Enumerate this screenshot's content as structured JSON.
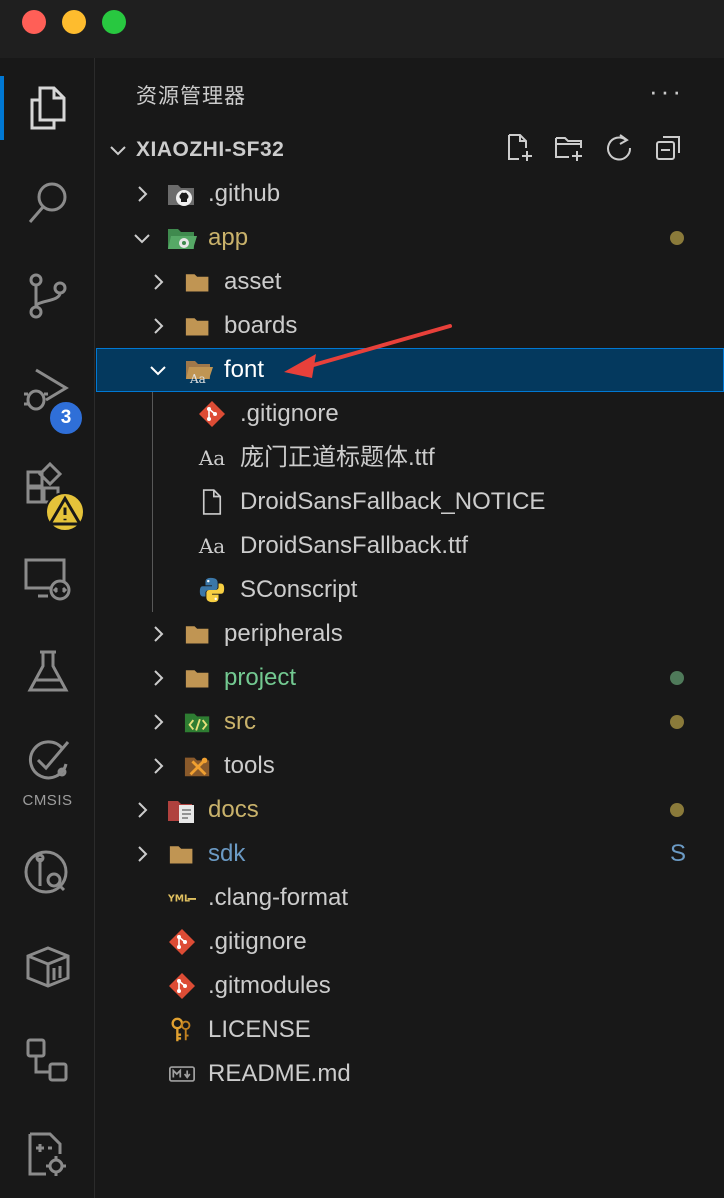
{
  "sidebar": {
    "title": "资源管理器",
    "more_label": "···",
    "root": {
      "label": "XIAOZHI-SF32"
    }
  },
  "activity": {
    "run_badge": "3",
    "cmsis_label": "CMSIS"
  },
  "tree": [
    {
      "label": ".github",
      "color": "#cccccc",
      "deco": ""
    },
    {
      "label": "app",
      "color": "#c9b26b",
      "deco": "#8a7a3a"
    },
    {
      "label": "asset",
      "color": "#cccccc",
      "deco": ""
    },
    {
      "label": "boards",
      "color": "#cccccc",
      "deco": ""
    },
    {
      "label": "font",
      "color": "#ffffff",
      "deco": ""
    },
    {
      "label": ".gitignore",
      "color": "#cccccc",
      "deco": ""
    },
    {
      "label": "庞门正道标题体.ttf",
      "color": "#cccccc",
      "deco": ""
    },
    {
      "label": "DroidSansFallback_NOTICE",
      "color": "#cccccc",
      "deco": ""
    },
    {
      "label": "DroidSansFallback.ttf",
      "color": "#cccccc",
      "deco": ""
    },
    {
      "label": "SConscript",
      "color": "#cccccc",
      "deco": ""
    },
    {
      "label": "peripherals",
      "color": "#cccccc",
      "deco": ""
    },
    {
      "label": "project",
      "color": "#73c991",
      "deco": "#4f7a5a"
    },
    {
      "label": "src",
      "color": "#c9b26b",
      "deco": "#8a7a3a"
    },
    {
      "label": "tools",
      "color": "#cccccc",
      "deco": ""
    },
    {
      "label": "docs",
      "color": "#c9b26b",
      "deco": "#8a7a3a"
    },
    {
      "label": "sdk",
      "color": "#6b9ac4",
      "deco_text": "S"
    },
    {
      "label": ".clang-format",
      "color": "#cccccc",
      "deco": ""
    },
    {
      "label": ".gitignore",
      "color": "#cccccc",
      "deco": ""
    },
    {
      "label": ".gitmodules",
      "color": "#cccccc",
      "deco": ""
    },
    {
      "label": "LICENSE",
      "color": "#cccccc",
      "deco": ""
    },
    {
      "label": "README.md",
      "color": "#cccccc",
      "deco": ""
    }
  ],
  "colors": {
    "background": "#181818",
    "selection": "#04395e",
    "accent": "#0078d4",
    "folder": "#c09553",
    "modified": "#c9b26b",
    "untracked": "#73c991",
    "submodule": "#6b9ac4"
  },
  "icons": [
    "explorer-icon",
    "search-icon",
    "source-control-icon",
    "run-debug-icon",
    "extensions-icon",
    "remote-explorer-icon",
    "testing-icon",
    "cmsis-icon",
    "gitlens-icon",
    "package-icon",
    "graph-icon",
    "settings-icon"
  ]
}
